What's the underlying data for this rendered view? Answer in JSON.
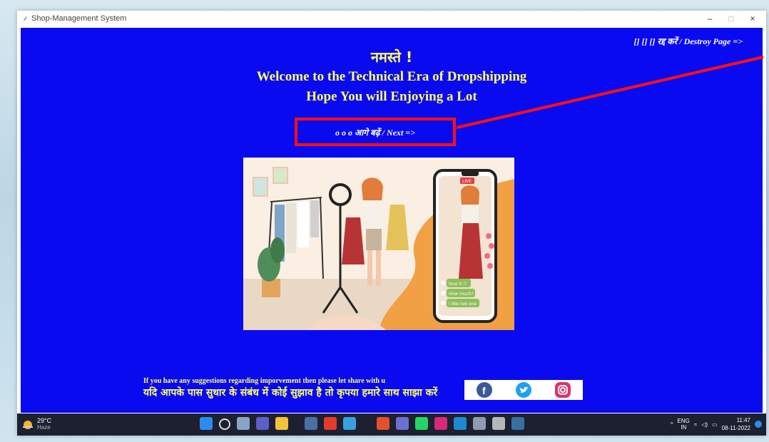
{
  "window": {
    "title": "Shop-Management System",
    "minimize": "–",
    "maximize": "□",
    "close": "×"
  },
  "page": {
    "destroy_label": "[] [] [] रद्द करें / Destroy Page =>",
    "greeting": "नमस्ते !",
    "welcome": "Welcome to the Technical Era of Dropshipping",
    "hope": "Hope You will Enjoying a Lot",
    "next_label": "o o o  आगे बढ़ें / Next =>",
    "suggest_en": "If you have any suggestions regarding imporvement then please let share with u",
    "suggest_hi": "यदि आपके पास सुधार के संबंध में कोई सुझाव है तो कृपया हमारे साथ साझा करें",
    "illustration": {
      "live_badge": "LIVE",
      "comments": [
        "love it !!",
        "How much?",
        "I like red one"
      ]
    }
  },
  "social": {
    "icons": [
      "facebook-icon",
      "twitter-icon",
      "instagram-icon"
    ],
    "facebook_glyph": "f"
  },
  "taskbar": {
    "temperature": "29°C",
    "condition": "Haze",
    "language": "ENG",
    "region": "IN",
    "time": "11:47",
    "date": "08-11-2022"
  },
  "colors": {
    "page_background": "#0a0af0",
    "heading_text": "#ffff66",
    "highlight_border": "#ff1010"
  }
}
